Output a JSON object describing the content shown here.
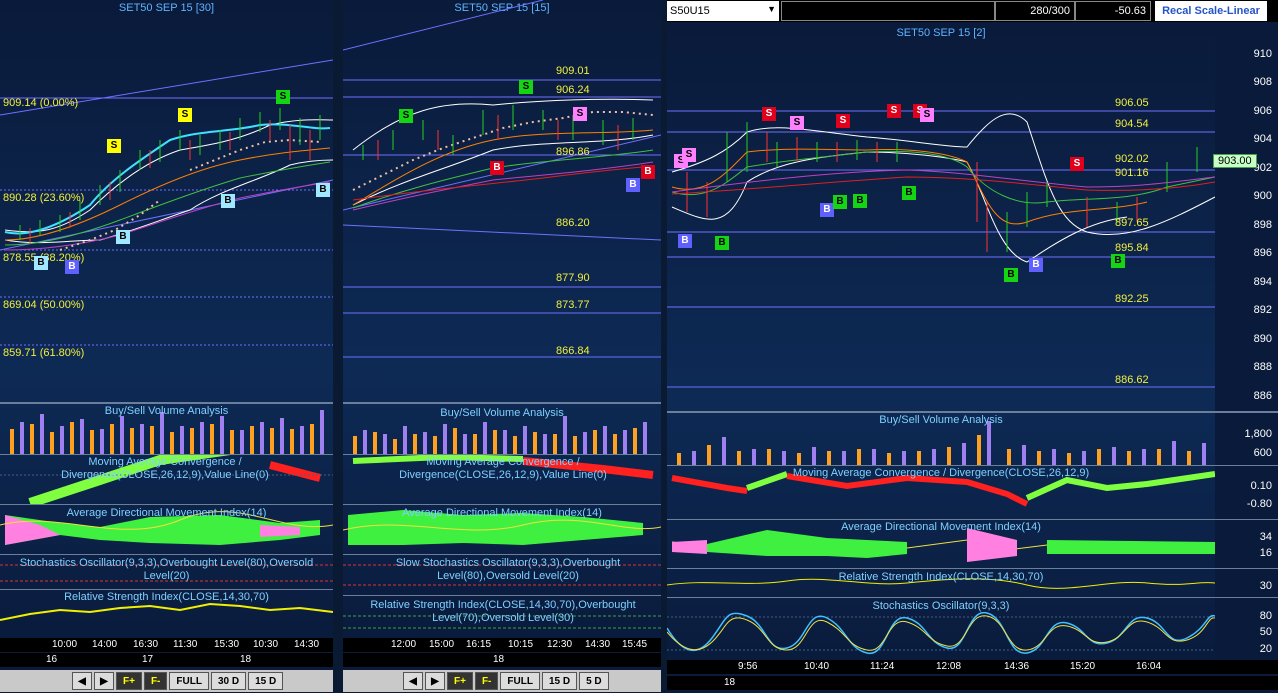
{
  "panel1": {
    "title": "SET50 SEP 15  [30]",
    "levels": [
      {
        "label": "909.14 (0.00%)"
      },
      {
        "label": "890.28 (23.60%)"
      },
      {
        "label": "878.55 (38.20%)"
      },
      {
        "label": "869.04 (50.00%)"
      },
      {
        "label": "859.71 (61.80%)"
      }
    ],
    "indicators": {
      "volume": "Buy/Sell Volume Analysis",
      "macd": "Moving Average Convergence / Divergence(CLOSE,26,12,9),Value Line(0)",
      "adx": "Average Directional Movement Index(14)",
      "stoch": "Stochastics Oscillator(9,3,3),Overbought Level(80),Oversold Level(20)",
      "rsi": "Relative Strength Index(CLOSE,14,30,70)"
    },
    "times": [
      "10:00",
      "14:00",
      "16:30",
      "11:30",
      "15:30",
      "10:30",
      "14:30"
    ],
    "days": [
      "16",
      "17",
      "18"
    ],
    "buttons": [
      "FULL",
      "30 D",
      "15 D"
    ]
  },
  "panel2": {
    "title": "SET50 SEP 15  [15]",
    "levels": [
      {
        "label": "909.01"
      },
      {
        "label": "906.24"
      },
      {
        "label": "896.86"
      },
      {
        "label": "886.20"
      },
      {
        "label": "877.90"
      },
      {
        "label": "873.77"
      },
      {
        "label": "866.84"
      }
    ],
    "indicators": {
      "volume": "Buy/Sell Volume Analysis",
      "macd": "Moving Average Convergence / Divergence(CLOSE,26,12,9),Value Line(0)",
      "adx": "Average Directional Movement Index(14)",
      "stoch": "Slow Stochastics Oscillator(9,3,3),Overbought Level(80),Oversold Level(20)",
      "rsi": "Relative Strength Index(CLOSE,14,30,70),Overbought Level(70),Oversold Level(30)"
    },
    "times": [
      "12:00",
      "15:00",
      "16:15",
      "10:15",
      "12:30",
      "14:30",
      "15:45"
    ],
    "days": [
      "18"
    ],
    "buttons": [
      "FULL",
      "15 D",
      "5 D"
    ]
  },
  "panel3": {
    "title": "SET50 SEP 15  [2]",
    "symbol": "S50U15",
    "bars_field": "280/300",
    "value_field": "-50.63",
    "recal_button": "Recal Scale-Linear",
    "current_price": "903.00",
    "axis_ticks": [
      "910",
      "908",
      "906",
      "904",
      "902",
      "900",
      "898",
      "896",
      "894",
      "892",
      "890",
      "888",
      "886"
    ],
    "levels": [
      {
        "label": "906.05"
      },
      {
        "label": "904.54"
      },
      {
        "label": "902.02"
      },
      {
        "label": "901.16"
      },
      {
        "label": "897.65"
      },
      {
        "label": "895.84"
      },
      {
        "label": "892.25"
      },
      {
        "label": "886.62"
      }
    ],
    "indicators": {
      "volume": "Buy/Sell Volume Analysis",
      "macd": "Moving Average Convergence / Divergence(CLOSE,26,12,9)",
      "adx": "Average Directional Movement Index(14)",
      "rsi": "Relative Strength Index(CLOSE,14,30,70)",
      "stoch": "Stochastics Oscillator(9,3,3)"
    },
    "volume_ticks": [
      "1,800",
      "600"
    ],
    "macd_ticks": [
      "0.10",
      "-0.80"
    ],
    "adx_ticks": [
      "34",
      "16"
    ],
    "rsi_ticks": [
      "30"
    ],
    "stoch_ticks": [
      "80",
      "50",
      "20"
    ],
    "times": [
      "9:56",
      "10:40",
      "11:24",
      "12:08",
      "14:36",
      "15:20",
      "16:04"
    ],
    "days": [
      "18"
    ]
  },
  "colors": {
    "level": "#f2ef3c",
    "indicator_label": "#7fd0ff",
    "title": "#5fb3ff",
    "buy_green": "#14d414",
    "sell_red": "#e0001b"
  }
}
